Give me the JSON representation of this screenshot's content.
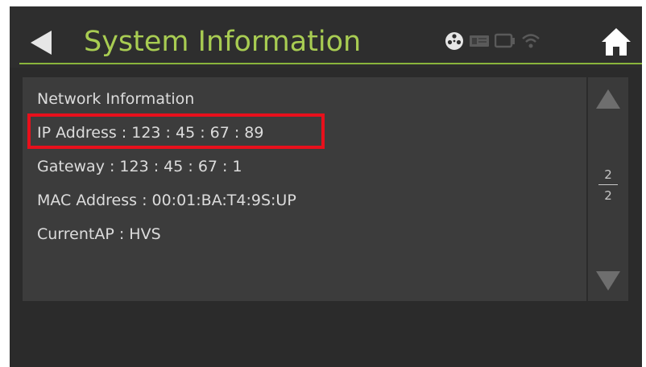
{
  "header": {
    "title": "System Information",
    "back_icon": "back-arrow-icon",
    "home_icon": "home-icon",
    "status_icons": [
      "disc-icon",
      "card-icon",
      "device-icon",
      "wifi-icon"
    ]
  },
  "content": {
    "section_title": "Network Information",
    "ip_address": "IP Address : 123 : 45 : 67 : 89",
    "gateway": "Gateway : 123 : 45 : 67 : 1",
    "mac_address": "MAC Address : 00:01:BA:T4:9S:UP",
    "current_ap": "CurrentAP : HVS"
  },
  "pager": {
    "current": "2",
    "total": "2"
  },
  "colors": {
    "accent": "#a8cc52",
    "highlight": "#e8101c",
    "background": "#2b2b2b",
    "panel": "#3c3c3c",
    "text": "#dcdcdc"
  }
}
